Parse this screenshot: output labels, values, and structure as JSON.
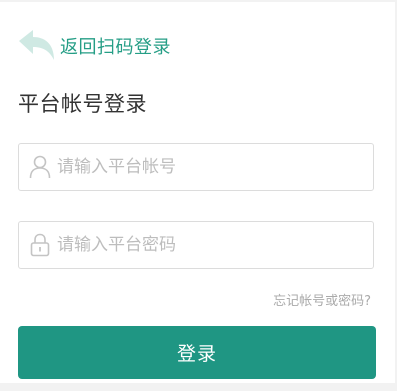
{
  "header": {
    "back_label": "返回扫码登录",
    "back_icon": "return-arrow-icon",
    "title": "平台帐号登录"
  },
  "form": {
    "username": {
      "icon": "user-icon",
      "value": "",
      "placeholder": "请输入平台帐号"
    },
    "password": {
      "icon": "lock-icon",
      "value": "",
      "placeholder": "请输入平台密码"
    },
    "forgot_label": "忘记帐号或密码?",
    "submit_label": "登录"
  },
  "colors": {
    "accent": "#1f9683",
    "link": "#259e86",
    "back_icon": "#cfe9e3",
    "border": "#dcdcdc",
    "placeholder": "#bdbdbd",
    "icon_gray": "#c4c4c4"
  }
}
